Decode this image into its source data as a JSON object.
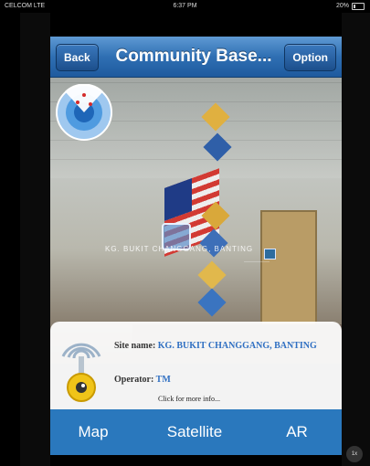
{
  "status_bar": {
    "carrier": "CELCOM LTE",
    "time": "6:37 PM",
    "battery": "20%"
  },
  "navbar": {
    "back_label": "Back",
    "title": "Community Base...",
    "option_label": "Option"
  },
  "ar_view": {
    "marker_label": "KG. BUKIT CHANGGANG, BANTING",
    "marker_small_label": "———————"
  },
  "info_panel": {
    "site_name_label": "Site name:",
    "site_name_value": "KG. BUKIT CHANGGANG, BANTING",
    "operator_label": "Operator:",
    "operator_value": "TM",
    "more_info": "Click for more info..."
  },
  "tabs": [
    {
      "label": "Map"
    },
    {
      "label": "Satellite"
    },
    {
      "label": "AR"
    }
  ],
  "zoom_badge": "1x",
  "colors": {
    "nav_blue": "#2f6fb3",
    "tab_blue": "#2a78bd",
    "link_blue": "#2f6fc2"
  }
}
